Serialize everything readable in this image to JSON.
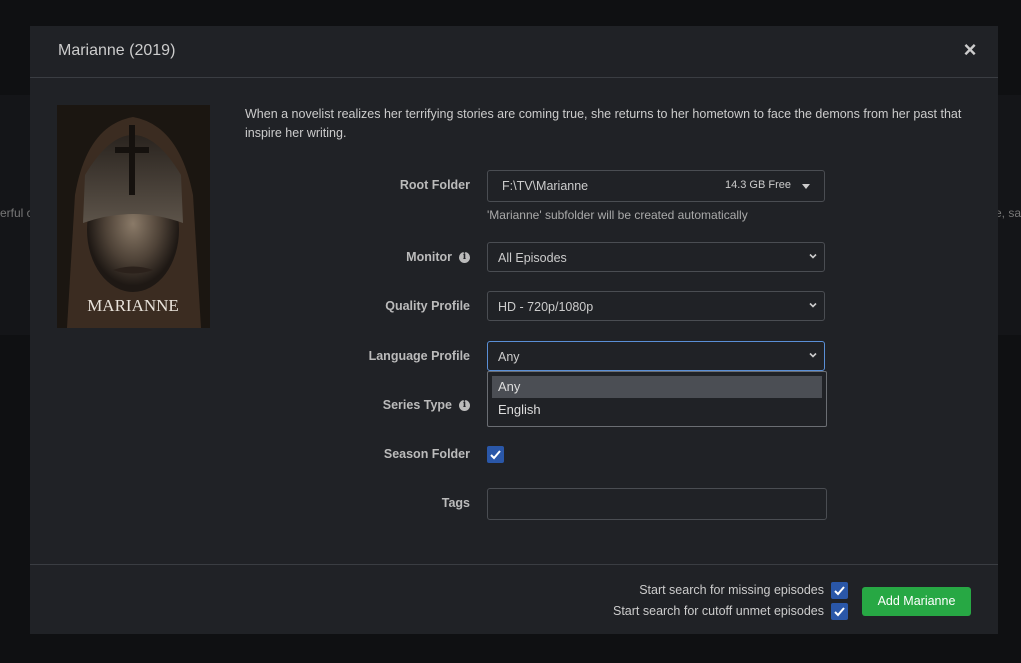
{
  "background": {
    "left_text": "erful c",
    "right_text": "e, sa"
  },
  "modal": {
    "title": "Marianne (2019)",
    "close_symbol": "×",
    "poster_text": "MARIANNE",
    "overview": "When a novelist realizes her terrifying stories are coming true, she returns to her hometown to face the demons from her past that inspire her writing."
  },
  "form": {
    "root_folder": {
      "label": "Root Folder",
      "value": "F:\\TV\\Marianne",
      "free_space": "14.3 GB Free",
      "help": "'Marianne' subfolder will be created automatically"
    },
    "monitor": {
      "label": "Monitor",
      "value": "All Episodes",
      "icon": "info-icon"
    },
    "quality_profile": {
      "label": "Quality Profile",
      "value": "HD - 720p/1080p"
    },
    "language_profile": {
      "label": "Language Profile",
      "value": "Any",
      "options": [
        "Any",
        "English"
      ],
      "selected_option": "Any"
    },
    "series_type": {
      "label": "Series Type",
      "icon": "info-icon"
    },
    "season_folder": {
      "label": "Season Folder",
      "checked": true
    },
    "tags": {
      "label": "Tags",
      "value": ""
    }
  },
  "footer": {
    "missing_label": "Start search for missing episodes",
    "missing_checked": true,
    "cutoff_label": "Start search for cutoff unmet episodes",
    "cutoff_checked": true,
    "add_button": "Add Marianne"
  },
  "colors": {
    "accent": "#27a844",
    "checkbox": "#2a57a8",
    "focus": "#5a8fd6"
  }
}
